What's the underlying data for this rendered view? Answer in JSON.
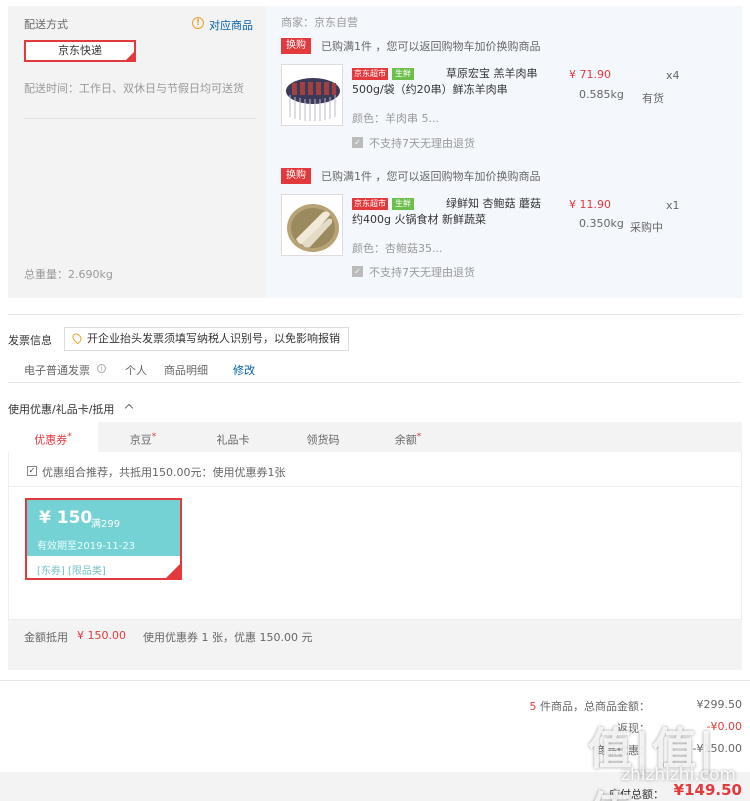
{
  "shipping": {
    "title": "配送方式",
    "match_link": "对应商品",
    "method": "京东快递",
    "time": "配送时间：工作日、双休日与节假日均可送货",
    "total_weight": "总重量：2.690kg"
  },
  "seller": "商家：京东自营",
  "products": [
    {
      "swap_tag": "换购",
      "swap_text": "已购满1件 ，您可以返回购物车加价换购商品",
      "tag_jd": "京东超市",
      "tag_fresh": "生鲜",
      "name": "草原宏宝 羔羊肉串 500g/袋（约20串）鲜冻羊肉串",
      "color": "颜色：羊肉串 5...",
      "no_return": "不支持7天无理由退货",
      "price": "¥ 71.90",
      "qty": "x4",
      "weight": "0.585kg",
      "stock": "有货"
    },
    {
      "swap_tag": "换购",
      "swap_text": "已购满1件 ，您可以返回购物车加价换购商品",
      "tag_jd": "京东超市",
      "tag_fresh": "生鲜",
      "name": "绿鲜知 杏鲍菇 蘑菇 约400g 火锅食材 新鲜蔬菜",
      "color": "颜色：杏鲍菇35...",
      "no_return": "不支持7天无理由退货",
      "price": "¥ 11.90",
      "qty": "x1",
      "weight": "0.350kg",
      "stock": "采购中"
    }
  ],
  "invoice": {
    "title": "发票信息",
    "tip": "开企业抬头发票须填写纳税人识别号，以免影响报销",
    "type": "电子普通发票",
    "personal": "个人",
    "detail": "商品明细",
    "edit": "修改"
  },
  "coupons": {
    "title": "使用优惠/礼品卡/抵用",
    "tabs": [
      {
        "label": "优惠券",
        "star": "*"
      },
      {
        "label": "京豆",
        "star": "*"
      },
      {
        "label": "礼品卡",
        "star": ""
      },
      {
        "label": "领货码",
        "star": ""
      },
      {
        "label": "余额",
        "star": "*"
      }
    ],
    "combo_text": "优惠组合推荐，共抵用150.00元：使用优惠券1张",
    "card": {
      "amount": "¥ 150",
      "condition": "满299",
      "expiry": "有效期至2019-11-23",
      "scope": "[东券] [限品类]"
    },
    "deduct_label": "金额抵用",
    "deduct_amount": "¥ 150.00",
    "deduct_desc": "使用优惠券 1 张，优惠 150.00 元"
  },
  "summary": {
    "count": "5",
    "count_label": " 件商品，总商品金额：",
    "total": "¥299.50",
    "row2_label": "返现：",
    "row2_value": "-¥0.00",
    "row3_label": "商品优惠：",
    "row3_value": "-¥150.00",
    "pay_label": "应付总额：",
    "pay_amount": "¥149.50"
  },
  "watermark": {
    "main": "值|值|值",
    "sub": "zhizhizhi.com"
  }
}
